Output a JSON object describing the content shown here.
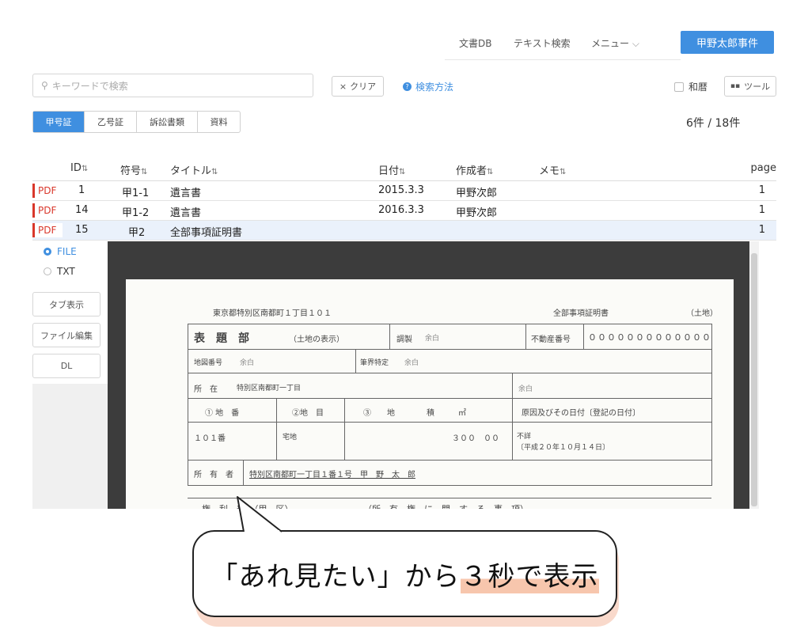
{
  "nav": {
    "items": [
      "文書DB",
      "テキスト検索",
      "メニュー"
    ],
    "case_name": "甲野太郎事件"
  },
  "search": {
    "placeholder": "キーワードで検索",
    "clear_label": "クリア",
    "howto_label": "検索方法",
    "wareki_label": "和暦",
    "tool_label": "ツール"
  },
  "tabs": [
    {
      "label": "甲号証",
      "active": true
    },
    {
      "label": "乙号証",
      "active": false
    },
    {
      "label": "訴訟書類",
      "active": false
    },
    {
      "label": "資料",
      "active": false
    }
  ],
  "count": "6件 / 18件",
  "table": {
    "headers": {
      "id": "ID",
      "symbol": "符号",
      "title": "タイトル",
      "date": "日付",
      "author": "作成者",
      "memo": "メモ",
      "page": "page"
    },
    "rows": [
      {
        "pdf": "PDF",
        "id": "1",
        "symbol": "甲1-1",
        "title": "遺言書",
        "date": "2015.3.3",
        "author": "甲野次郎",
        "page": "1"
      },
      {
        "pdf": "PDF",
        "id": "14",
        "symbol": "甲1-2",
        "title": "遺言書",
        "date": "2016.3.3",
        "author": "甲野次郎",
        "page": "1"
      },
      {
        "pdf": "PDF",
        "id": "15",
        "symbol": "甲2",
        "title": "全部事項証明書",
        "date": "",
        "author": "",
        "page": "1"
      }
    ]
  },
  "side": {
    "radio_file": "FILE",
    "radio_txt": "TXT",
    "tab_view": "タブ表示",
    "file_edit": "ファイル編集",
    "dl": "DL"
  },
  "document": {
    "address_head": "東京都特別区南都町１丁目１０１",
    "doc_type": "全部事項証明書",
    "land": "（土地）",
    "hyodai": "表　題　部",
    "hyodai_sub": "（土地の表示）",
    "chosei": "調製",
    "yohaku": "余白",
    "fudosan_label": "不動産番号",
    "fudosan_no": "０００００００００００００",
    "chizu_label": "地図番号",
    "hikkai_label": "筆界特定",
    "shozai_label": "所　在",
    "shozai_value": "特別区南都町一丁目",
    "col1": "① 地　番",
    "col2": "②地　目",
    "col3": "③　　地　　　　積　　　㎡",
    "col4": "原因及びその日付〔登記の日付〕",
    "chiban": "１０１番",
    "chimoku": "宅地",
    "chiseki": "３００　００",
    "genin1": "不詳",
    "genin2": "〔平成２０年１０月１４日〕",
    "shoyusha_label": "所　有　者",
    "shoyusha_value": "特別区南都町一丁目１番１号　甲　野　太　郎",
    "kenri_label": "権　利　部　（甲　区）",
    "kenri_sub": "（所　有　権　に　関　す　る　事　項）"
  },
  "callout": {
    "text_before": "「あれ見たい」から",
    "text_highlight": "３秒で表示"
  }
}
